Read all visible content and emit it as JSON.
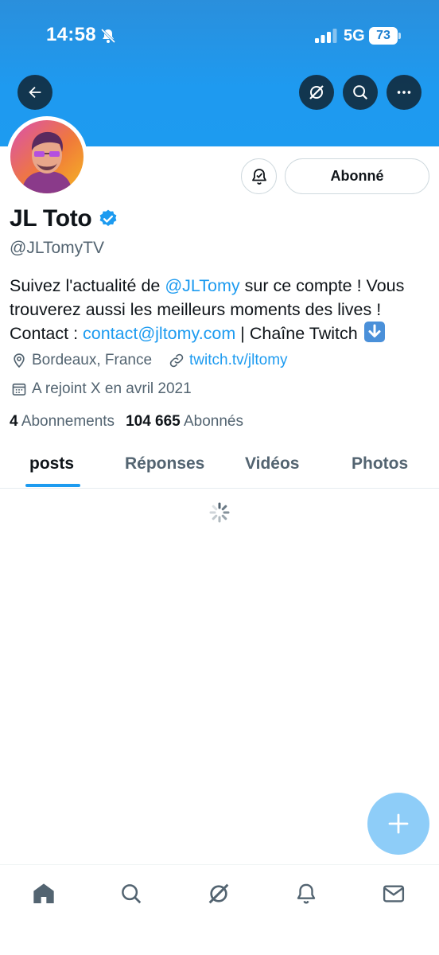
{
  "status_bar": {
    "time": "14:58",
    "network": "5G",
    "battery": "73"
  },
  "profile": {
    "display_name": "JL Toto",
    "handle": "@JLTomyTV",
    "follow_button_label": "Abonné",
    "bio": {
      "part1": "Suivez l'actualité de ",
      "mention": "@JLTomy",
      "part2": " sur ce compte ! Vous trouverez aussi les meilleurs moments des lives ! Contact : ",
      "email": "contact@jltomy.com",
      "part3": " | Chaîne Twitch "
    },
    "location": "Bordeaux, France",
    "website": "twitch.tv/jltomy",
    "joined": "A rejoint X en avril 2021",
    "following_count": "4",
    "following_label": "Abonnements",
    "followers_count": "104 665",
    "followers_label": "Abonnés"
  },
  "tabs": [
    {
      "label": "posts",
      "active": true
    },
    {
      "label": "Réponses",
      "active": false
    },
    {
      "label": "Vidéos",
      "active": false
    },
    {
      "label": "Photos",
      "active": false
    }
  ],
  "colors": {
    "accent": "#1d9bf0",
    "banner": "#1d9bf0",
    "secondary_text": "#536471"
  },
  "icons": {
    "header": [
      "back-arrow-icon",
      "grok-icon",
      "search-icon",
      "more-icon"
    ],
    "bottom_nav": [
      "home-icon",
      "search-icon",
      "grok-icon",
      "notifications-icon",
      "messages-icon"
    ]
  }
}
